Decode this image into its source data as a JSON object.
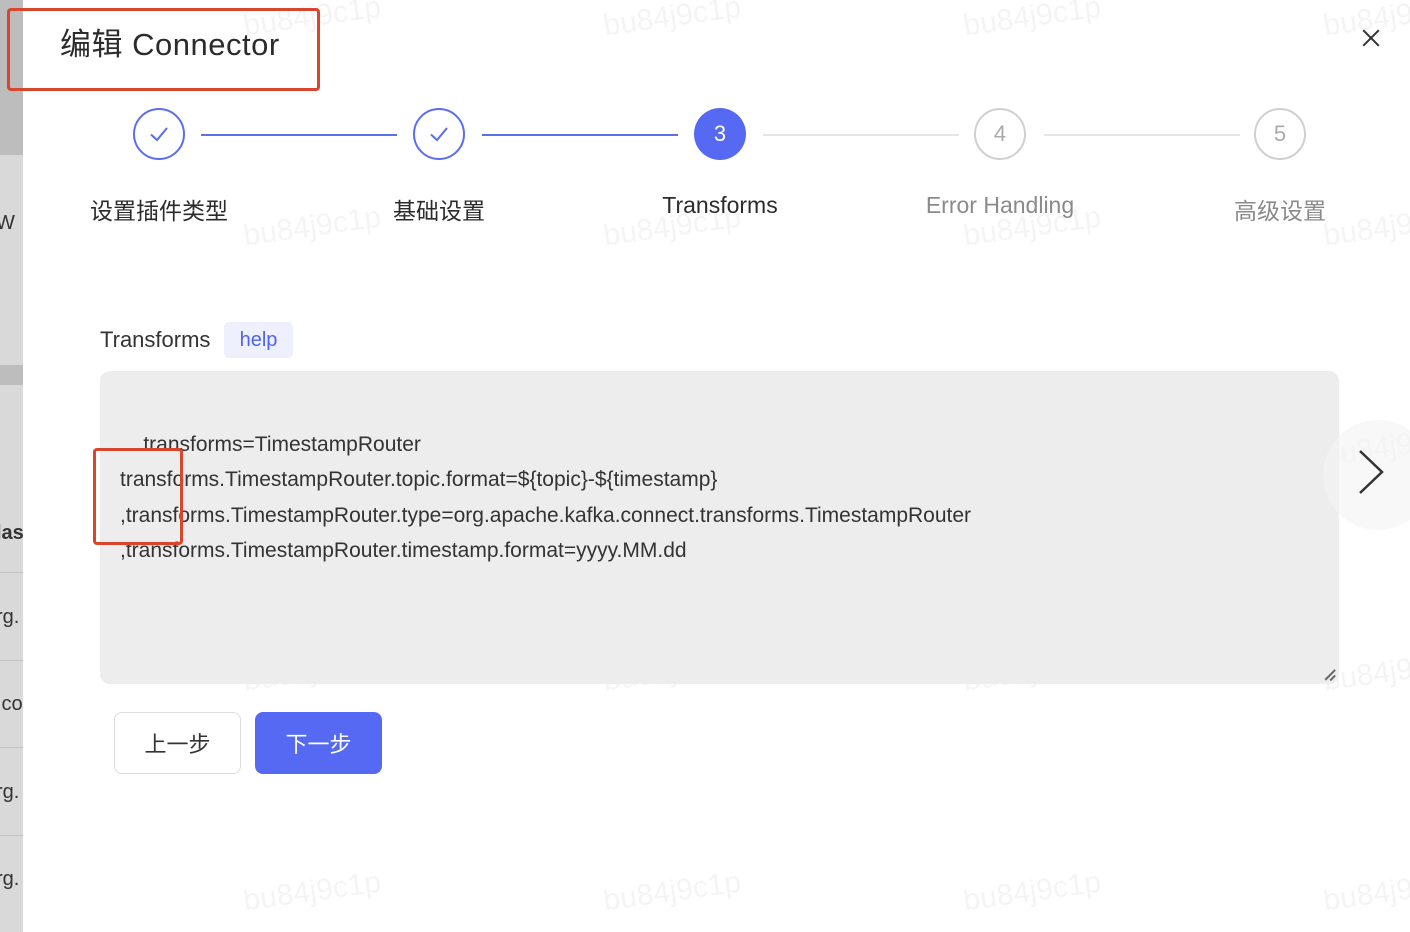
{
  "modal": {
    "title": "编辑 Connector"
  },
  "steps": [
    {
      "number": "1",
      "label": "设置插件类型",
      "status": "done"
    },
    {
      "number": "2",
      "label": "基础设置",
      "status": "done"
    },
    {
      "number": "3",
      "label": "Transforms",
      "status": "active"
    },
    {
      "number": "4",
      "label": "Error Handling",
      "status": "todo"
    },
    {
      "number": "5",
      "label": "高级设置",
      "status": "todo"
    }
  ],
  "form": {
    "field_label": "Transforms",
    "help_label": "help",
    "transforms_value": "transforms=TimestampRouter\ntransforms.TimestampRouter.topic.format=${topic}-${timestamp}\n,transforms.TimestampRouter.type=org.apache.kafka.connect.transforms.TimestampRouter\n,transforms.TimestampRouter.timestamp.format=yyyy.MM.dd"
  },
  "buttons": {
    "prev_label": "上一步",
    "next_label": "下一步"
  },
  "watermark": "bu84j9c1p",
  "backdrop_fragments": [
    "W",
    "las",
    "rg.",
    ".co",
    "rg.",
    "rg."
  ],
  "colors": {
    "accent": "#5669f3",
    "highlight_border": "#d9452d"
  }
}
